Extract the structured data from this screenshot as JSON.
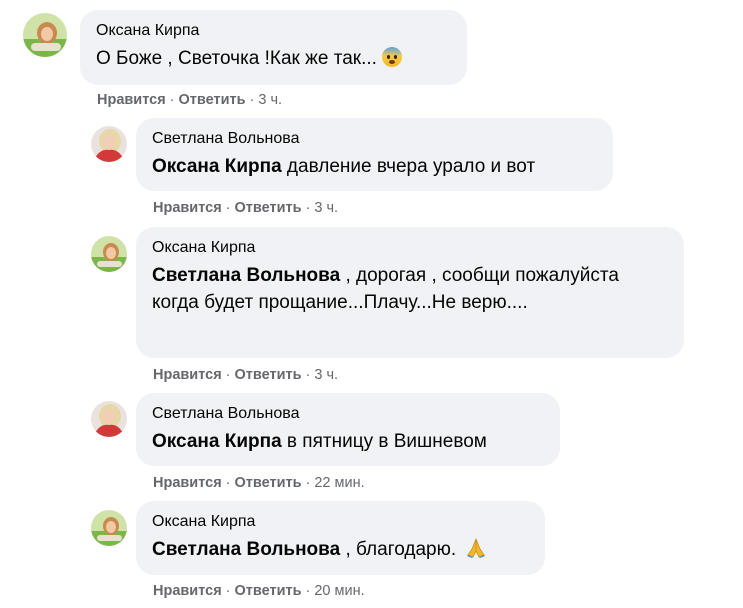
{
  "colors": {
    "bubble_bg": "#f0f2f5",
    "meta_text": "#65676b",
    "text": "#050505"
  },
  "comments": [
    {
      "author": "Оксана Кирпа",
      "mention": "",
      "text": "О Боже , Светочка !Как же так...",
      "emoji": "anxious-face-with-sweat-icon",
      "like_label": "Нравится",
      "reply_label": "Ответить",
      "sep": "·",
      "time": "3 ч."
    },
    {
      "author": "Светлана Вольнова",
      "mention": "Оксана Кирпа",
      "text": " давление вчера урало и вот",
      "like_label": "Нравится",
      "reply_label": "Ответить",
      "sep": "·",
      "time": "3 ч."
    },
    {
      "author": "Оксана Кирпа",
      "mention": "Светлана Вольнова",
      "text": " , дорогая , сообщи пожалуйста когда будет прощание...Плачу...Не верю....",
      "like_label": "Нравится",
      "reply_label": "Ответить",
      "sep": "·",
      "time": "3 ч."
    },
    {
      "author": "Светлана Вольнова",
      "mention": "Оксана Кирпа",
      "text": " в пятницу в Вишневом",
      "like_label": "Нравится",
      "reply_label": "Ответить",
      "sep": "·",
      "time": "22 мин."
    },
    {
      "author": "Оксана Кирпа",
      "mention": "Светлана Вольнова",
      "text": " , благодарю. ",
      "emoji": "folded-hands-icon",
      "like_label": "Нравится",
      "reply_label": "Ответить",
      "sep": "·",
      "time": "20 мин."
    }
  ]
}
